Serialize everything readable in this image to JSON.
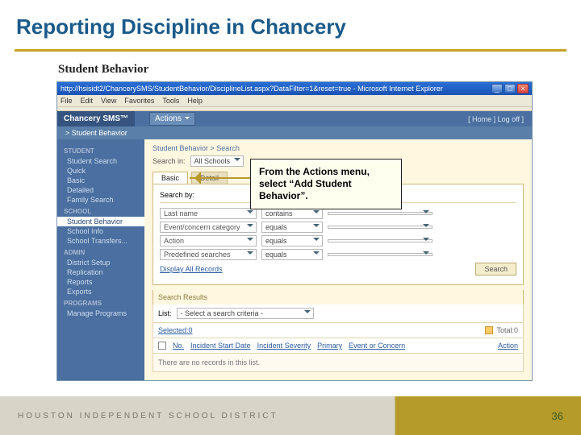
{
  "slide": {
    "title": "Reporting Discipline in Chancery",
    "section": "Student Behavior",
    "page_number": "36",
    "footer_brand": "HOUSTON INDEPENDENT SCHOOL DISTRICT"
  },
  "callout": {
    "text": "From the Actions menu, select “Add Student Behavior”."
  },
  "browser": {
    "title": "http://hsisidt2/ChancerySMS/StudentBehavior/DisciplineList.aspx?DataFilter=1&reset=true - Microsoft Internet Explorer",
    "menus": [
      "File",
      "Edit",
      "View",
      "Favorites",
      "Tools",
      "Help"
    ]
  },
  "app": {
    "logo": "Chancery SMS™",
    "breadcrumb": "> Student Behavior",
    "actions_label": "Actions",
    "home_label": "[ Home ]",
    "logoff_label": "Log off ]"
  },
  "sidebar": {
    "groups": [
      {
        "label": "STUDENT",
        "items": [
          "Student Search",
          "Quick",
          "Basic",
          "Detailed",
          "Family Search"
        ]
      },
      {
        "label": "SCHOOL",
        "items": [
          "Student Behavior",
          "School Info",
          "School Transfers..."
        ]
      },
      {
        "label": "ADMIN",
        "items": [
          "District Setup",
          "Replication",
          "Reports",
          "Exports"
        ]
      },
      {
        "label": "PROGRAMS",
        "items": [
          "Manage Programs"
        ]
      }
    ],
    "active": "Student Behavior"
  },
  "main": {
    "crumb": "Student Behavior > Search",
    "search_in_label": "Search in:",
    "search_in_value": "All Schools",
    "tabs": [
      "Basic",
      "Detail"
    ],
    "active_tab": "Basic",
    "search_by_label": "Search by:",
    "rows": [
      {
        "label": "Last name",
        "op": "contains",
        "val": ""
      },
      {
        "label": "Event/concern category",
        "op": "equals",
        "val": ""
      },
      {
        "label": "Action",
        "op": "equals",
        "val": ""
      },
      {
        "label": "Predefined searches",
        "op": "equals",
        "val": ""
      }
    ],
    "display_all": "Display All Records",
    "search_btn": "Search",
    "results_hdr": "Search Results",
    "list_label": "List:",
    "list_value": "- Select a search criteria -",
    "selected_label": "Selected:0",
    "total_label": "Total:0",
    "columns": [
      "No.",
      "Incident Start Date",
      "Incident Severity",
      "Primary",
      "Event or Concern",
      "Action"
    ],
    "no_records": "There are no records in this list."
  }
}
